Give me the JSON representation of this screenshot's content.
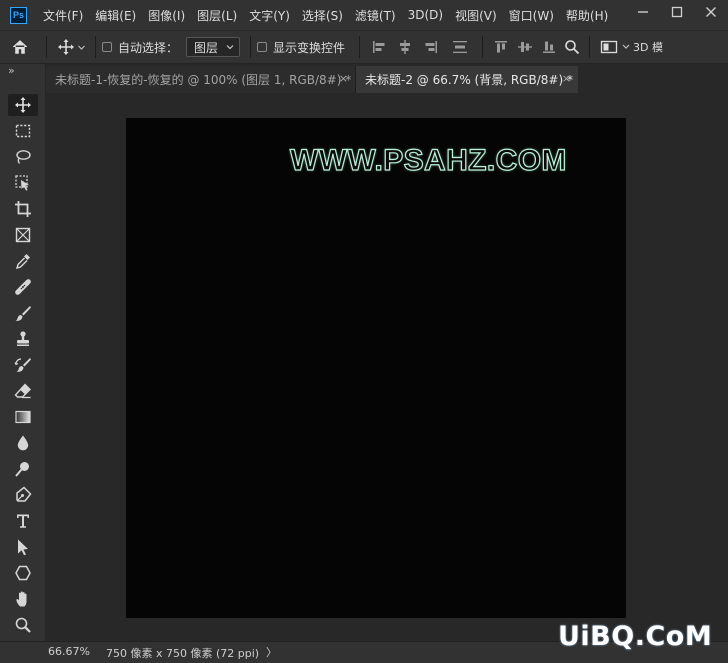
{
  "app": {
    "logo": "Ps",
    "menu": [
      "文件(F)",
      "编辑(E)",
      "图像(I)",
      "图层(L)",
      "文字(Y)",
      "选择(S)",
      "滤镜(T)",
      "3D(D)",
      "视图(V)",
      "窗口(W)",
      "帮助(H)"
    ],
    "window_controls": [
      "minimize-icon",
      "maximize-icon",
      "close-icon"
    ]
  },
  "options": {
    "auto_select_label": "自动选择：",
    "auto_select_target": "图层",
    "show_transform_label": "显示变换控件",
    "mode_3d_label": "3D 模"
  },
  "tabs": [
    {
      "label": "未标题-1-恢复的-恢复的 @ 100% (图层 1, RGB/8#) *",
      "close": "×",
      "active": false
    },
    {
      "label": "未标题-2 @ 66.7% (背景, RGB/8#) *",
      "close": "×",
      "active": true
    }
  ],
  "panel_collapse": "»",
  "tools": [
    "move-icon",
    "marquee-icon",
    "lasso-icon",
    "object-select-icon",
    "crop-icon",
    "frame-icon",
    "eyedropper-icon",
    "healing-icon",
    "brush-icon",
    "stamp-icon",
    "history-brush-icon",
    "eraser-icon",
    "gradient-icon",
    "blur-icon",
    "dodge-icon",
    "pen-icon",
    "type-icon",
    "path-select-icon",
    "shape-icon",
    "hand-icon",
    "zoom-icon",
    "more-icon"
  ],
  "canvas": {
    "text": "WWW.PSAHZ.COM",
    "background": "#050505",
    "text_stroke_color": "#b9f0d6"
  },
  "status": {
    "zoom": "66.67%",
    "doc_info": "750 像素 x 750 像素 (72 ppi)",
    "arrow": "〉"
  },
  "watermark": "UiBQ.CoM",
  "colors": {
    "accent": "#31a8ff",
    "panel": "#323232",
    "workspace": "#282828"
  }
}
